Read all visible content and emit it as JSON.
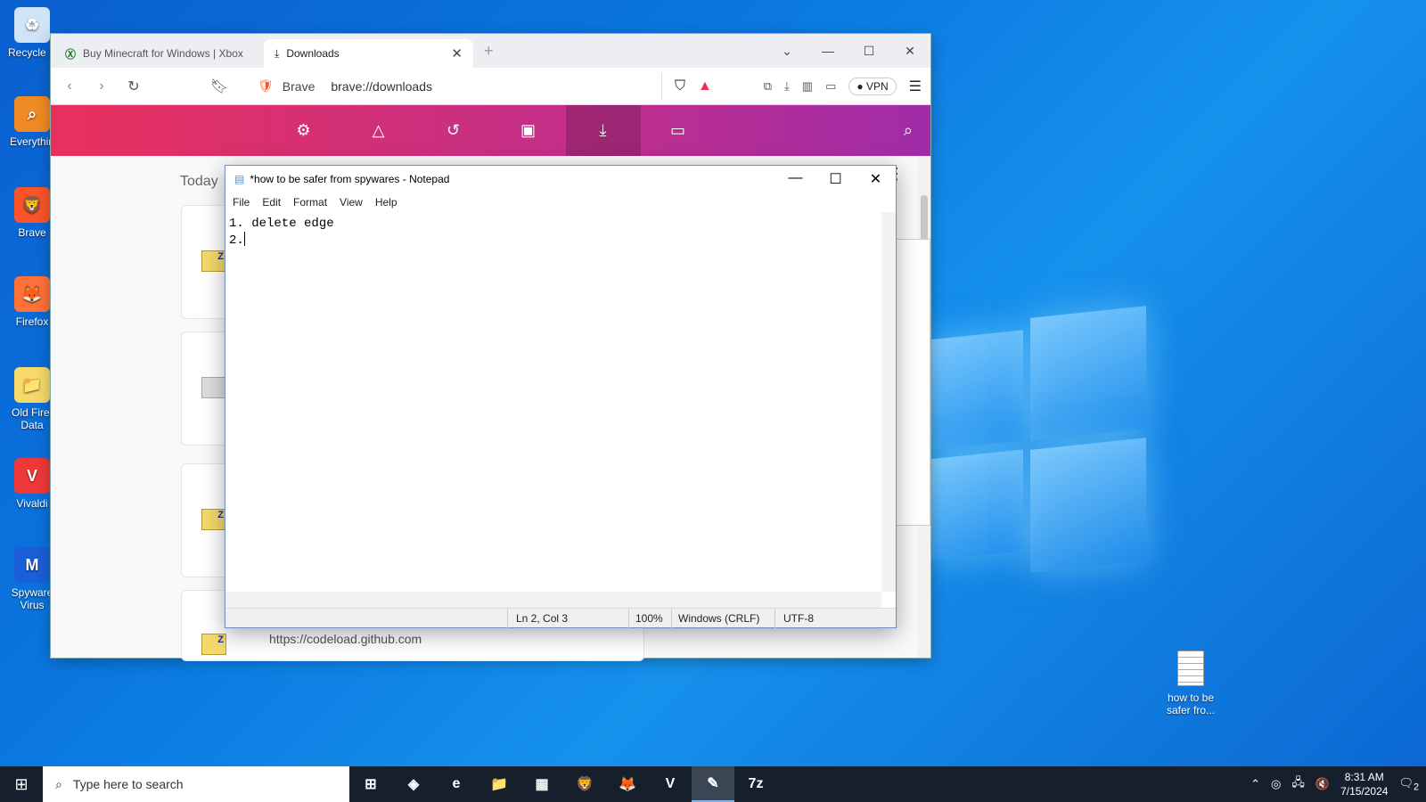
{
  "desktop_icons": [
    {
      "label": "Recycle B",
      "glyph": "♻",
      "color": "#d0e4f7"
    },
    {
      "label": "Everythin",
      "glyph": "⌕",
      "color": "#f08a24"
    },
    {
      "label": "Brave",
      "glyph": "🦁",
      "color": "#fb542b"
    },
    {
      "label": "Firefox",
      "glyph": "🦊",
      "color": "#ff7139"
    },
    {
      "label": "Old Firef Data",
      "glyph": "📁",
      "color": "#f5d96b"
    },
    {
      "label": "Vivaldi",
      "glyph": "V",
      "color": "#ef3939"
    },
    {
      "label": "Spyware Virus",
      "glyph": "M",
      "color": "#1a5fd8"
    }
  ],
  "desktop_file": {
    "label": "how to be safer fro...",
    "icon": "text-file-icon"
  },
  "browser": {
    "tabs": [
      {
        "label": "Buy Minecraft for Windows | Xbox",
        "icon": "xbox-icon"
      },
      {
        "label": "Downloads",
        "icon": "download-icon"
      }
    ],
    "brave_label": "Brave",
    "url": "brave://downloads",
    "vpn": "VPN",
    "section_today": "Today",
    "partial_url": "https://codeload.github.com",
    "accent": "#e8305c"
  },
  "notepad": {
    "title": "*how to be safer from spywares - Notepad",
    "menu": [
      "File",
      "Edit",
      "Format",
      "View",
      "Help"
    ],
    "line1": "1. delete edge",
    "line2": "2.",
    "status": {
      "position": "Ln 2, Col 3",
      "zoom": "100%",
      "eol": "Windows (CRLF)",
      "encoding": "UTF-8"
    }
  },
  "taskbar": {
    "search_placeholder": "Type here to search",
    "time": "8:31 AM",
    "date": "7/15/2024",
    "notification_count": "2",
    "apps": [
      {
        "name": "task-view-icon",
        "glyph": "⊞"
      },
      {
        "name": "copilot-icon",
        "glyph": "◈"
      },
      {
        "name": "edge-icon",
        "glyph": "e"
      },
      {
        "name": "file-explorer-icon",
        "glyph": "📁"
      },
      {
        "name": "store-icon",
        "glyph": "▦"
      },
      {
        "name": "brave-icon",
        "glyph": "🦁"
      },
      {
        "name": "firefox-icon",
        "glyph": "🦊"
      },
      {
        "name": "vivaldi-icon",
        "glyph": "V"
      },
      {
        "name": "notepad-icon",
        "glyph": "✎"
      },
      {
        "name": "7zip-icon",
        "glyph": "7z"
      }
    ]
  }
}
